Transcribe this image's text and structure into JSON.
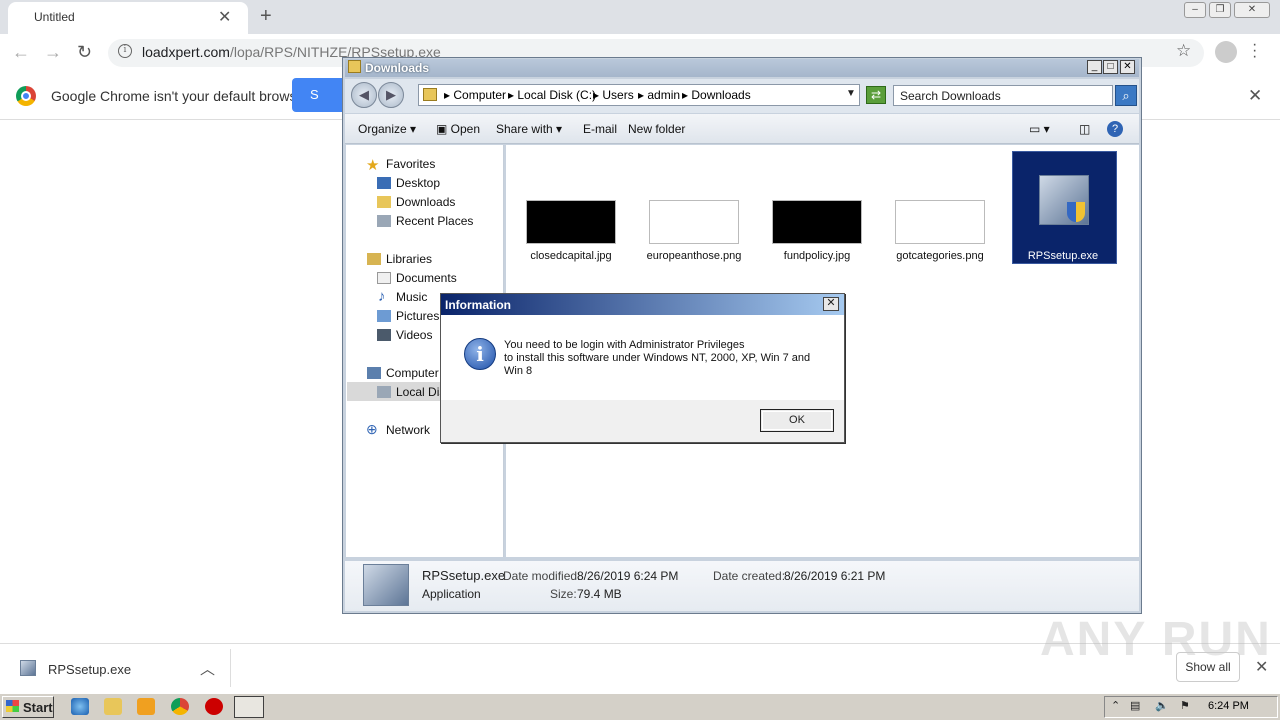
{
  "browser": {
    "tab_title": "Untitled",
    "url_host": "loadxpert.com",
    "url_path": "/lopa/RPS/NITHZE/RPSsetup.exe",
    "infobar_text": "Google Chrome isn't your default browser",
    "set_default_label": "S",
    "download_name": "RPSsetup.exe",
    "show_all_label": "Show all",
    "watermark": "ANY RUN"
  },
  "explorer": {
    "title": "Downloads",
    "breadcrumbs": [
      "Computer",
      "Local Disk (C:)",
      "Users",
      "admin",
      "Downloads"
    ],
    "search_placeholder": "Search Downloads",
    "commands": {
      "organize": "Organize",
      "open": "Open",
      "share": "Share with",
      "email": "E-mail",
      "newfolder": "New folder"
    },
    "nav": {
      "favorites": "Favorites",
      "desktop": "Desktop",
      "downloads": "Downloads",
      "recent": "Recent Places",
      "libraries": "Libraries",
      "documents": "Documents",
      "music": "Music",
      "pictures": "Pictures",
      "videos": "Videos",
      "computer": "Computer",
      "localdisk": "Local Disk",
      "network": "Network"
    },
    "files": [
      "closedcapital.jpg",
      "europeanthose.png",
      "fundpolicy.jpg",
      "gotcategories.png",
      "RPSsetup.exe"
    ],
    "details": {
      "name": "RPSsetup.exe",
      "type": "Application",
      "modified_label": "Date modified:",
      "modified": "8/26/2019 6:24 PM",
      "created_label": "Date created:",
      "created": "8/26/2019 6:21 PM",
      "size_label": "Size:",
      "size": "79.4 MB"
    }
  },
  "dialog": {
    "title": "Information",
    "line1": "You need to be login with Administrator Privileges",
    "line2": "to install this software under Windows NT, 2000, XP, Win 7 and",
    "line3": "Win 8",
    "ok": "OK"
  },
  "taskbar": {
    "start": "Start",
    "clock": "6:24 PM"
  }
}
